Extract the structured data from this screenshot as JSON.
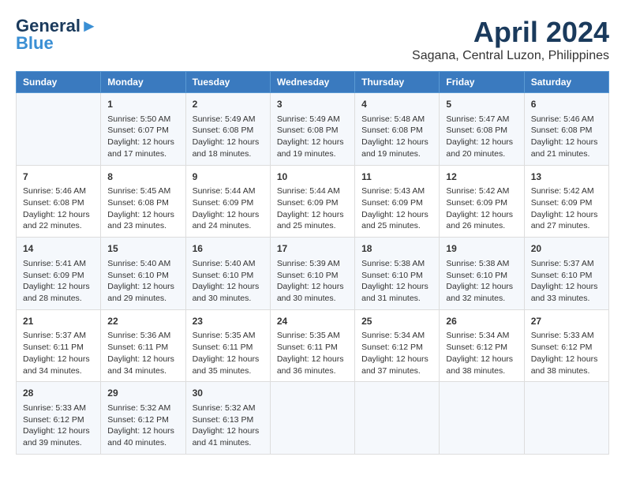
{
  "logo": {
    "line1": "General",
    "line2": "Blue"
  },
  "title": "April 2024",
  "subtitle": "Sagana, Central Luzon, Philippines",
  "days_of_week": [
    "Sunday",
    "Monday",
    "Tuesday",
    "Wednesday",
    "Thursday",
    "Friday",
    "Saturday"
  ],
  "weeks": [
    [
      {
        "day": "",
        "info": ""
      },
      {
        "day": "1",
        "info": "Sunrise: 5:50 AM\nSunset: 6:07 PM\nDaylight: 12 hours\nand 17 minutes."
      },
      {
        "day": "2",
        "info": "Sunrise: 5:49 AM\nSunset: 6:08 PM\nDaylight: 12 hours\nand 18 minutes."
      },
      {
        "day": "3",
        "info": "Sunrise: 5:49 AM\nSunset: 6:08 PM\nDaylight: 12 hours\nand 19 minutes."
      },
      {
        "day": "4",
        "info": "Sunrise: 5:48 AM\nSunset: 6:08 PM\nDaylight: 12 hours\nand 19 minutes."
      },
      {
        "day": "5",
        "info": "Sunrise: 5:47 AM\nSunset: 6:08 PM\nDaylight: 12 hours\nand 20 minutes."
      },
      {
        "day": "6",
        "info": "Sunrise: 5:46 AM\nSunset: 6:08 PM\nDaylight: 12 hours\nand 21 minutes."
      }
    ],
    [
      {
        "day": "7",
        "info": "Sunrise: 5:46 AM\nSunset: 6:08 PM\nDaylight: 12 hours\nand 22 minutes."
      },
      {
        "day": "8",
        "info": "Sunrise: 5:45 AM\nSunset: 6:08 PM\nDaylight: 12 hours\nand 23 minutes."
      },
      {
        "day": "9",
        "info": "Sunrise: 5:44 AM\nSunset: 6:09 PM\nDaylight: 12 hours\nand 24 minutes."
      },
      {
        "day": "10",
        "info": "Sunrise: 5:44 AM\nSunset: 6:09 PM\nDaylight: 12 hours\nand 25 minutes."
      },
      {
        "day": "11",
        "info": "Sunrise: 5:43 AM\nSunset: 6:09 PM\nDaylight: 12 hours\nand 25 minutes."
      },
      {
        "day": "12",
        "info": "Sunrise: 5:42 AM\nSunset: 6:09 PM\nDaylight: 12 hours\nand 26 minutes."
      },
      {
        "day": "13",
        "info": "Sunrise: 5:42 AM\nSunset: 6:09 PM\nDaylight: 12 hours\nand 27 minutes."
      }
    ],
    [
      {
        "day": "14",
        "info": "Sunrise: 5:41 AM\nSunset: 6:09 PM\nDaylight: 12 hours\nand 28 minutes."
      },
      {
        "day": "15",
        "info": "Sunrise: 5:40 AM\nSunset: 6:10 PM\nDaylight: 12 hours\nand 29 minutes."
      },
      {
        "day": "16",
        "info": "Sunrise: 5:40 AM\nSunset: 6:10 PM\nDaylight: 12 hours\nand 30 minutes."
      },
      {
        "day": "17",
        "info": "Sunrise: 5:39 AM\nSunset: 6:10 PM\nDaylight: 12 hours\nand 30 minutes."
      },
      {
        "day": "18",
        "info": "Sunrise: 5:38 AM\nSunset: 6:10 PM\nDaylight: 12 hours\nand 31 minutes."
      },
      {
        "day": "19",
        "info": "Sunrise: 5:38 AM\nSunset: 6:10 PM\nDaylight: 12 hours\nand 32 minutes."
      },
      {
        "day": "20",
        "info": "Sunrise: 5:37 AM\nSunset: 6:10 PM\nDaylight: 12 hours\nand 33 minutes."
      }
    ],
    [
      {
        "day": "21",
        "info": "Sunrise: 5:37 AM\nSunset: 6:11 PM\nDaylight: 12 hours\nand 34 minutes."
      },
      {
        "day": "22",
        "info": "Sunrise: 5:36 AM\nSunset: 6:11 PM\nDaylight: 12 hours\nand 34 minutes."
      },
      {
        "day": "23",
        "info": "Sunrise: 5:35 AM\nSunset: 6:11 PM\nDaylight: 12 hours\nand 35 minutes."
      },
      {
        "day": "24",
        "info": "Sunrise: 5:35 AM\nSunset: 6:11 PM\nDaylight: 12 hours\nand 36 minutes."
      },
      {
        "day": "25",
        "info": "Sunrise: 5:34 AM\nSunset: 6:12 PM\nDaylight: 12 hours\nand 37 minutes."
      },
      {
        "day": "26",
        "info": "Sunrise: 5:34 AM\nSunset: 6:12 PM\nDaylight: 12 hours\nand 38 minutes."
      },
      {
        "day": "27",
        "info": "Sunrise: 5:33 AM\nSunset: 6:12 PM\nDaylight: 12 hours\nand 38 minutes."
      }
    ],
    [
      {
        "day": "28",
        "info": "Sunrise: 5:33 AM\nSunset: 6:12 PM\nDaylight: 12 hours\nand 39 minutes."
      },
      {
        "day": "29",
        "info": "Sunrise: 5:32 AM\nSunset: 6:12 PM\nDaylight: 12 hours\nand 40 minutes."
      },
      {
        "day": "30",
        "info": "Sunrise: 5:32 AM\nSunset: 6:13 PM\nDaylight: 12 hours\nand 41 minutes."
      },
      {
        "day": "",
        "info": ""
      },
      {
        "day": "",
        "info": ""
      },
      {
        "day": "",
        "info": ""
      },
      {
        "day": "",
        "info": ""
      }
    ]
  ]
}
